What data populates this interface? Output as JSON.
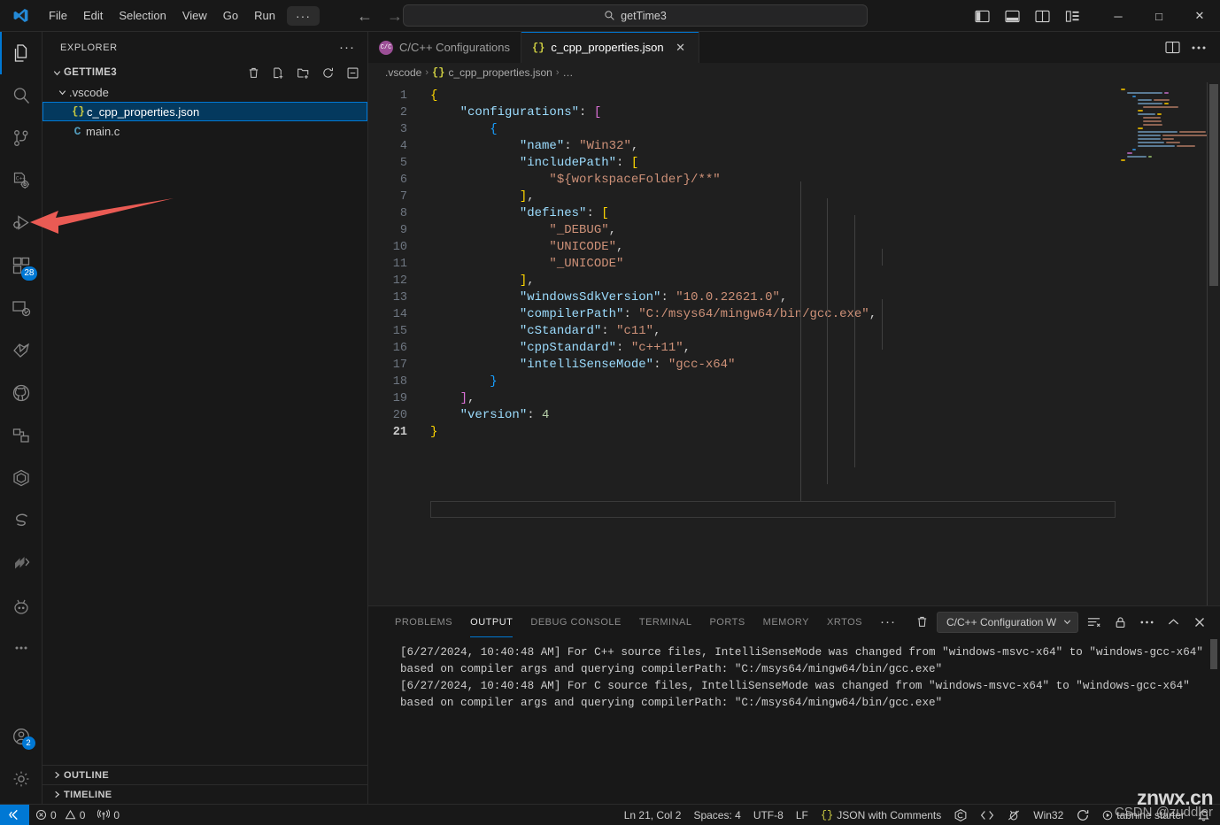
{
  "titlebar": {
    "menu": [
      "File",
      "Edit",
      "Selection",
      "View",
      "Go",
      "Run"
    ],
    "more_label": "···",
    "back_label": "←",
    "forward_label": "→",
    "command_center_text": "getTime3",
    "minimize_label": "─",
    "maximize_label": "□",
    "close_label": "✕"
  },
  "activitybar": {
    "items": [
      {
        "name": "explorer",
        "tooltip": "Explorer",
        "badge": ""
      },
      {
        "name": "search",
        "tooltip": "Search",
        "badge": ""
      },
      {
        "name": "source-control",
        "tooltip": "Source Control",
        "badge": ""
      },
      {
        "name": "cpp-runner",
        "tooltip": "C/C++ Runner",
        "badge": ""
      },
      {
        "name": "run-and-debug",
        "tooltip": "Run and Debug",
        "badge": ""
      },
      {
        "name": "extensions",
        "tooltip": "Extensions",
        "badge": "28"
      },
      {
        "name": "remote-explorer",
        "tooltip": "Remote Explorer",
        "badge": ""
      },
      {
        "name": "embedded-tools",
        "tooltip": "Embedded Tools",
        "badge": ""
      },
      {
        "name": "github",
        "tooltip": "GitHub",
        "badge": ""
      },
      {
        "name": "dependency-graph",
        "tooltip": "Dependencies",
        "badge": ""
      },
      {
        "name": "platformio",
        "tooltip": "PlatformIO",
        "badge": ""
      },
      {
        "name": "segger",
        "tooltip": "SEGGER",
        "badge": ""
      },
      {
        "name": "keil",
        "tooltip": "Keil Assistant",
        "badge": ""
      },
      {
        "name": "tabnine",
        "tooltip": "Tabnine",
        "badge": ""
      },
      {
        "name": "more-views",
        "tooltip": "Additional Views",
        "badge": ""
      }
    ],
    "accounts": {
      "tooltip": "Accounts",
      "badge": "2"
    },
    "settings": {
      "tooltip": "Manage"
    }
  },
  "sidebar": {
    "title": "EXPLORER",
    "more_label": "···",
    "folder": "GETTIME3",
    "folder_actions": [
      "delete-icon",
      "new-file-icon",
      "new-folder-icon",
      "refresh-icon",
      "collapse-all-icon"
    ],
    "tree": [
      {
        "label": ".vscode",
        "type": "folder",
        "expanded": true,
        "depth": 1,
        "selected": false
      },
      {
        "label": "c_cpp_properties.json",
        "type": "json",
        "depth": 2,
        "selected": true
      },
      {
        "label": "main.c",
        "type": "c",
        "depth": 2,
        "selected": false
      }
    ],
    "sections": [
      {
        "label": "OUTLINE",
        "expanded": false
      },
      {
        "label": "TIMELINE",
        "expanded": false
      }
    ]
  },
  "editor": {
    "tabs": [
      {
        "label": "C/C++ Configurations",
        "icon": "cpp-config-icon",
        "active": false,
        "closable": false
      },
      {
        "label": "c_cpp_properties.json",
        "icon": "json-icon",
        "active": true,
        "closable": true,
        "close_label": "✕"
      }
    ],
    "tab_actions": [
      "split-editor-icon",
      "more-actions-icon"
    ],
    "breadcrumb": [
      ".vscode",
      "c_cpp_properties.json",
      "…"
    ],
    "breadcrumb_separator": "›",
    "file_icon_label": "{}",
    "lines": [
      {
        "n": 1,
        "text": "{"
      },
      {
        "n": 2,
        "text": "    \"configurations\": ["
      },
      {
        "n": 3,
        "text": "        {"
      },
      {
        "n": 4,
        "text": "            \"name\": \"Win32\","
      },
      {
        "n": 5,
        "text": "            \"includePath\": ["
      },
      {
        "n": 6,
        "text": "                \"${workspaceFolder}/**\""
      },
      {
        "n": 7,
        "text": "            ],"
      },
      {
        "n": 8,
        "text": "            \"defines\": ["
      },
      {
        "n": 9,
        "text": "                \"_DEBUG\","
      },
      {
        "n": 10,
        "text": "                \"UNICODE\","
      },
      {
        "n": 11,
        "text": "                \"_UNICODE\""
      },
      {
        "n": 12,
        "text": "            ],"
      },
      {
        "n": 13,
        "text": "            \"windowsSdkVersion\": \"10.0.22621.0\","
      },
      {
        "n": 14,
        "text": "            \"compilerPath\": \"C:/msys64/mingw64/bin/gcc.exe\","
      },
      {
        "n": 15,
        "text": "            \"cStandard\": \"c11\","
      },
      {
        "n": 16,
        "text": "            \"cppStandard\": \"c++11\","
      },
      {
        "n": 17,
        "text": "            \"intelliSenseMode\": \"gcc-x64\""
      },
      {
        "n": 18,
        "text": "        }"
      },
      {
        "n": 19,
        "text": "    ],"
      },
      {
        "n": 20,
        "text": "    \"version\": 4"
      },
      {
        "n": 21,
        "text": "}"
      }
    ]
  },
  "panel": {
    "tabs": [
      {
        "label": "PROBLEMS",
        "active": false
      },
      {
        "label": "OUTPUT",
        "active": true
      },
      {
        "label": "DEBUG CONSOLE",
        "active": false
      },
      {
        "label": "TERMINAL",
        "active": false
      },
      {
        "label": "PORTS",
        "active": false
      },
      {
        "label": "MEMORY",
        "active": false
      },
      {
        "label": "XRTOS",
        "active": false
      }
    ],
    "more_label": "···",
    "channel_selected": "C/C++ Configuration W",
    "chevron": "⌄",
    "actions": [
      "clear-output-icon",
      "filter-icon",
      "lock-icon",
      "more-actions-icon",
      "maximize-panel-icon",
      "close-panel-icon"
    ],
    "output_lines": [
      "[6/27/2024, 10:40:48 AM] For C++ source files, IntelliSenseMode was changed from \"windows-msvc-x64\" to \"windows-gcc-x64\" based on compiler args and querying compilerPath: \"C:/msys64/mingw64/bin/gcc.exe\"",
      "[6/27/2024, 10:40:48 AM] For C source files, IntelliSenseMode was changed from \"windows-msvc-x64\" to \"windows-gcc-x64\" based on compiler args and querying compilerPath: \"C:/msys64/mingw64/bin/gcc.exe\""
    ]
  },
  "statusbar": {
    "remote_icon": "remote-window-icon",
    "errors": "0",
    "warnings": "0",
    "ports": "0",
    "cursor_position": "Ln 21, Col 2",
    "indentation": "Spaces: 4",
    "encoding": "UTF-8",
    "eol": "LF",
    "language": "JSON with Comments",
    "language_icon": "{}",
    "right_icons": [
      "cpp-tools-icon",
      "code-tour-icon",
      "bug-icon"
    ],
    "config_name": "Win32",
    "sync_icon": "sync-icon",
    "tabnine_label": "tabnine starter",
    "bell_icon": "bell-icon"
  },
  "annotation": {
    "arrow_color": "#ea5b54",
    "watermark_line1": "znwx.cn",
    "watermark_line2": "CSDN @zuddler"
  },
  "colors": {
    "accent": "#0078d4",
    "selected_tree": "#04395e",
    "string": "#ce9178",
    "key": "#9cdcfe",
    "number": "#b5cea8",
    "bracket1": "#ffd700",
    "bracket2": "#da70d6",
    "bracket3": "#179fff",
    "bg_editor": "#1f1f1f",
    "bg_chrome": "#181818"
  }
}
